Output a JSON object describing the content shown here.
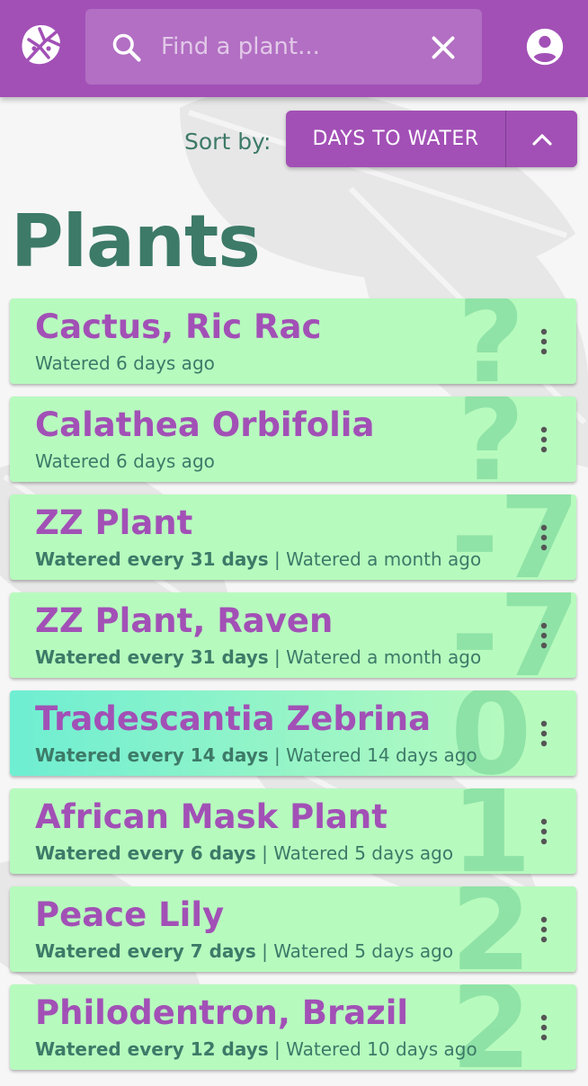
{
  "app": {
    "search": {
      "placeholder": "Find a plant...",
      "value": ""
    },
    "icons": {
      "logo": "monstera-leaf-icon",
      "search": "search-icon",
      "clear": "close-icon",
      "account": "account-circle-icon"
    }
  },
  "sort": {
    "label": "Sort by:",
    "value": "DAYS TO WATER",
    "direction": "ascending"
  },
  "page": {
    "title": "Plants"
  },
  "colors": {
    "header": "#a250b6",
    "accent_green": "#3d7a68",
    "card": "#b7fabe",
    "highlight": "#6eeed2"
  },
  "plants": [
    {
      "name": "Cactus, Ric Rac",
      "schedule": "",
      "sep": "",
      "watered": "Watered 6 days ago",
      "days": "?"
    },
    {
      "name": "Calathea Orbifolia",
      "schedule": "",
      "sep": "",
      "watered": "Watered 6 days ago",
      "days": "?"
    },
    {
      "name": "ZZ Plant",
      "schedule": "Watered every 31 days",
      "sep": " | ",
      "watered": "Watered a month ago",
      "days": "-7"
    },
    {
      "name": "ZZ Plant, Raven",
      "schedule": "Watered every 31 days",
      "sep": " | ",
      "watered": "Watered a month ago",
      "days": "-7"
    },
    {
      "name": "Tradescantia Zebrina",
      "schedule": "Watered every 14 days",
      "sep": " | ",
      "watered": "Watered 14 days ago",
      "days": "0"
    },
    {
      "name": "African Mask Plant",
      "schedule": "Watered every 6 days",
      "sep": " | ",
      "watered": "Watered 5 days ago",
      "days": "1"
    },
    {
      "name": "Peace Lily",
      "schedule": "Watered every 7 days",
      "sep": " | ",
      "watered": "Watered 5 days ago",
      "days": "2"
    },
    {
      "name": "Philodentron, Brazil",
      "schedule": "Watered every 12 days",
      "sep": " | ",
      "watered": "Watered 10 days ago",
      "days": "2"
    }
  ]
}
